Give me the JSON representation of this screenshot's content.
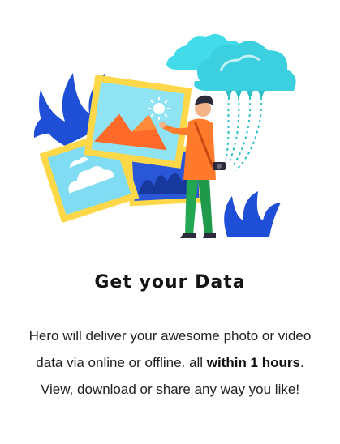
{
  "feature": {
    "illustration": "person-uploading-photos-to-cloud-illustration",
    "title": "Get your Data",
    "description": {
      "part1": "Hero will deliver your awesome photo or video data via online or offline. all ",
      "highlight": "within 1 hours",
      "part2": ". View, download or share any way you like!"
    }
  },
  "colors": {
    "cloud": "#3fd6e6",
    "frame": "#ffd84a",
    "leaves": "#1f4fd6",
    "text": "#222222",
    "title": "#151515"
  }
}
